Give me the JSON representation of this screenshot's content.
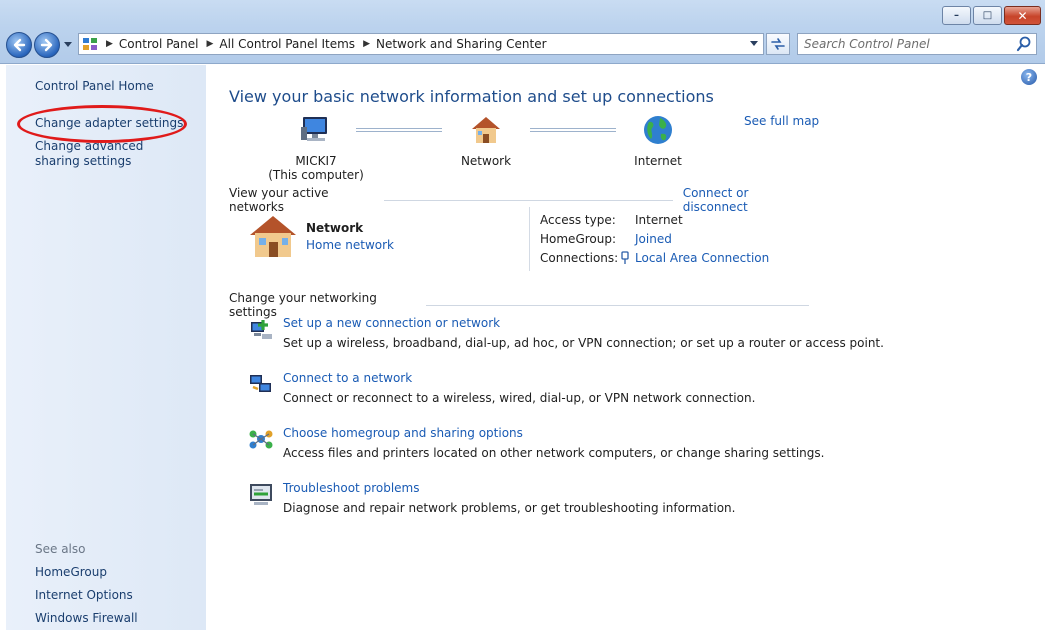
{
  "window": {
    "minimize_label": "–",
    "maximize_label": "□",
    "close_label": "✕"
  },
  "address_bar": {
    "breadcrumbs": [
      "Control Panel",
      "All Control Panel Items",
      "Network and Sharing Center"
    ]
  },
  "search": {
    "placeholder": "Search Control Panel"
  },
  "sidebar": {
    "home": "Control Panel Home",
    "adapter": "Change adapter settings",
    "advanced": "Change advanced sharing settings",
    "see_also": "See also",
    "see_also_links": [
      "HomeGroup",
      "Internet Options",
      "Windows Firewall"
    ]
  },
  "main": {
    "help_label": "?",
    "heading": "View your basic network information and set up connections",
    "see_full_map": "See full map",
    "map": {
      "computer_name": "MICKI7",
      "computer_sub": "(This computer)",
      "network": "Network",
      "internet": "Internet"
    },
    "active_networks": {
      "title": "View your active networks",
      "connect_link": "Connect or disconnect",
      "network_name": "Network",
      "network_type": "Home network",
      "access_type_label": "Access type:",
      "access_type_value": "Internet",
      "homegroup_label": "HomeGroup:",
      "homegroup_value": "Joined",
      "connections_label": "Connections:",
      "connections_value": "Local Area Connection"
    },
    "settings": {
      "title": "Change your networking settings",
      "tasks": [
        {
          "title": "Set up a new connection or network",
          "desc": "Set up a wireless, broadband, dial-up, ad hoc, or VPN connection; or set up a router or access point."
        },
        {
          "title": "Connect to a network",
          "desc": "Connect or reconnect to a wireless, wired, dial-up, or VPN network connection."
        },
        {
          "title": "Choose homegroup and sharing options",
          "desc": "Access files and printers located on other network computers, or change sharing settings."
        },
        {
          "title": "Troubleshoot problems",
          "desc": "Diagnose and repair network problems, or get troubleshooting information."
        }
      ]
    }
  },
  "colors": {
    "link": "#1a5bb4",
    "heading": "#1e4c8b",
    "highlight_ellipse": "#e01a1a"
  }
}
